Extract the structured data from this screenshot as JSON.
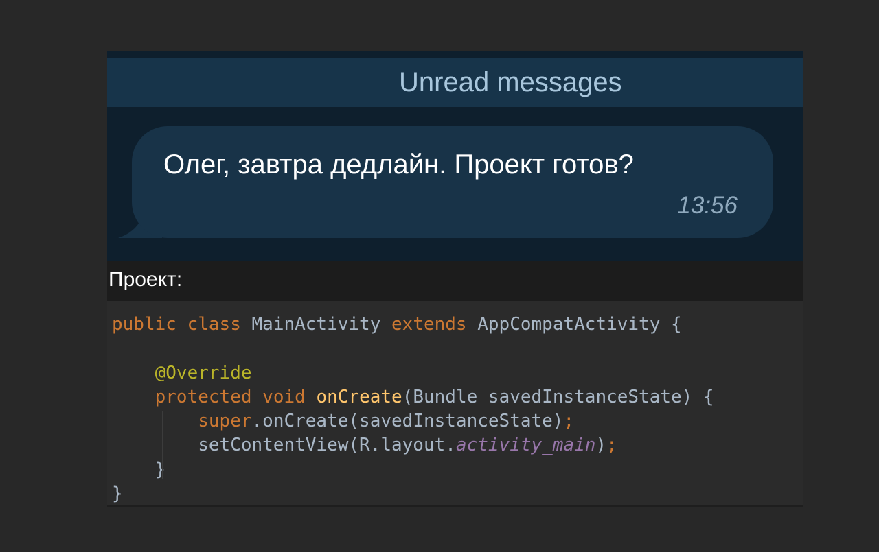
{
  "chat": {
    "unread_label": "Unread messages",
    "message": {
      "text": "Олег, завтра дедлайн. Проект готов?",
      "time": "13:56"
    }
  },
  "caption": "Проект:",
  "code": {
    "line1": {
      "kw1": "public",
      "kw2": "class",
      "name": "MainActivity",
      "kw3": "extends",
      "parent": "AppCompatActivity",
      "brace": "{"
    },
    "annotation": "@Override",
    "method": {
      "kw1": "protected",
      "kw2": "void",
      "name": "onCreate",
      "params": "(Bundle savedInstanceState) {"
    },
    "super_call": {
      "kw": "super",
      "rest": ".onCreate(savedInstanceState)",
      "semi": ";"
    },
    "set_content": {
      "prefix": "setContentView(R.layout.",
      "field": "activity_main",
      "suffix": ")",
      "semi": ";"
    },
    "close_inner": "}",
    "close_outer": "}"
  },
  "colors": {
    "keyword": "#cc7832",
    "annotation": "#bbb529",
    "method": "#ffc66d",
    "field": "#9876aa",
    "plain": "#a9b7c6",
    "chat_bg": "#0e1f2d",
    "bubble": "#183348",
    "unread_bar": "#17344a"
  }
}
